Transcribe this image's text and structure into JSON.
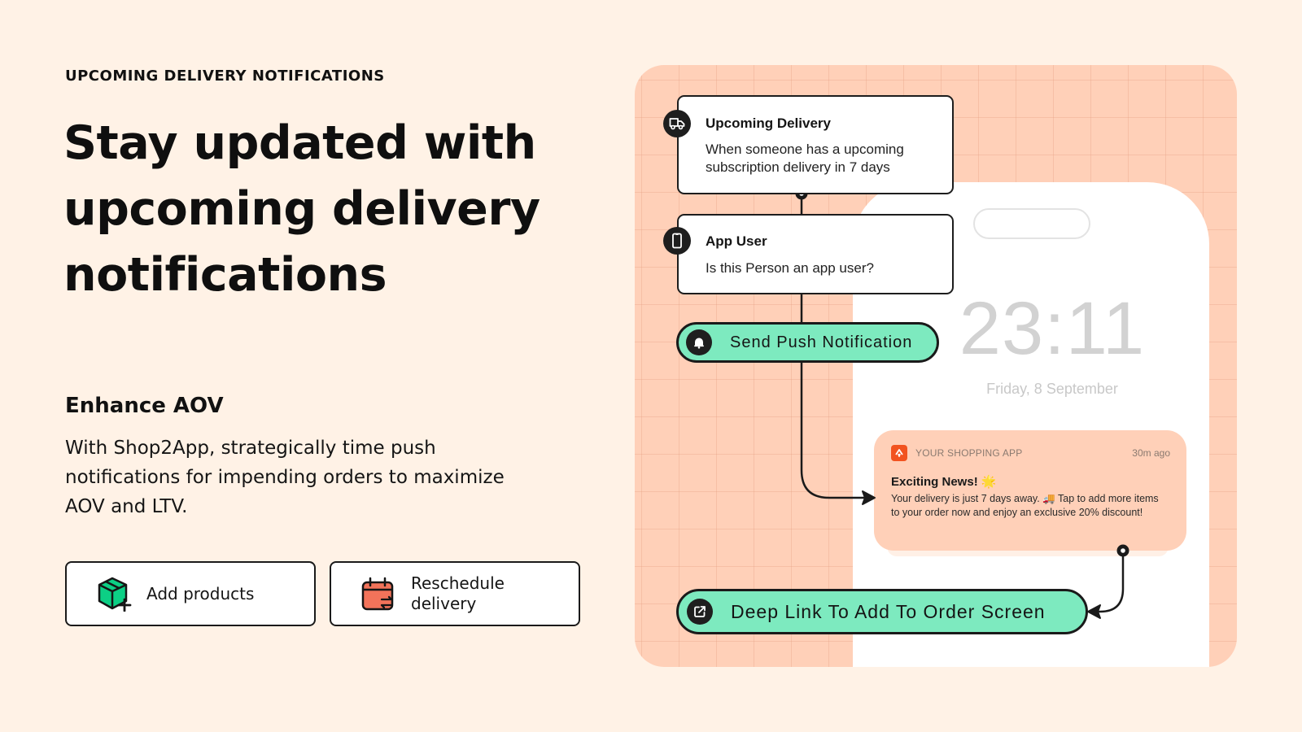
{
  "eyebrow": "UPCOMING DELIVERY NOTIFICATIONS",
  "headline": "Stay updated with upcoming delivery notifications",
  "feature": {
    "title": "Enhance AOV",
    "description": "With Shop2App, strategically time push notifications for impending orders to maximize AOV and LTV."
  },
  "chips": [
    {
      "label": "Add products",
      "icon": "box-plus-icon",
      "color": "#0ccf85"
    },
    {
      "label": "Reschedule delivery",
      "icon": "calendar-swap-icon",
      "color": "#f2735a"
    }
  ],
  "flow": {
    "trigger": {
      "title": "Upcoming Delivery",
      "description": "When someone has a upcoming subscription delivery in 7 days",
      "icon": "truck-icon"
    },
    "condition": {
      "title": "App User",
      "description": "Is this Person an app user?",
      "icon": "phone-icon"
    },
    "action": {
      "label": "Send Push Notification",
      "icon": "bell-icon"
    },
    "deep_link": {
      "label": "Deep Link To Add To Order Screen",
      "icon": "external-link-icon"
    }
  },
  "phone": {
    "time": "23:11",
    "date": "Friday, 8 September",
    "notification": {
      "app_name": "YOUR SHOPPING APP",
      "time_ago": "30m ago",
      "title": "Exciting News! 🌟",
      "body": "Your delivery is just 7 days away. 🚚 Tap to add more items to your order now and enjoy an exclusive 20% discount!"
    }
  },
  "colors": {
    "background": "#fff2e6",
    "panel": "#ffd0b8",
    "accent_green": "#7deabf",
    "app_icon": "#f2531f"
  }
}
